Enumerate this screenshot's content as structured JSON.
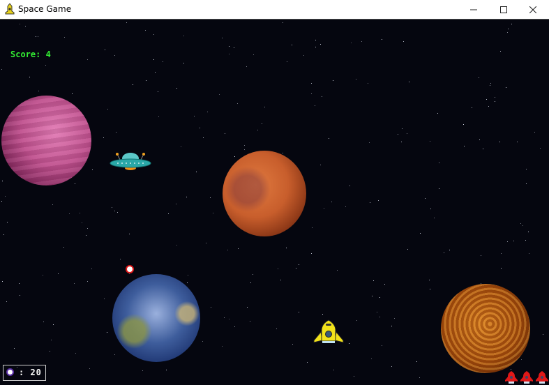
{
  "window": {
    "title": "Space Game",
    "minimize_icon": "minimize-icon",
    "maximize_icon": "maximize-icon",
    "close_icon": "close-icon"
  },
  "hud": {
    "score_label": "Score: 4",
    "ammo_text": ": 20",
    "lives": 3
  },
  "colors": {
    "score": "#33ee33",
    "background": "#05060f",
    "player": "#f2e21a",
    "enemy_life": "#e01818"
  }
}
